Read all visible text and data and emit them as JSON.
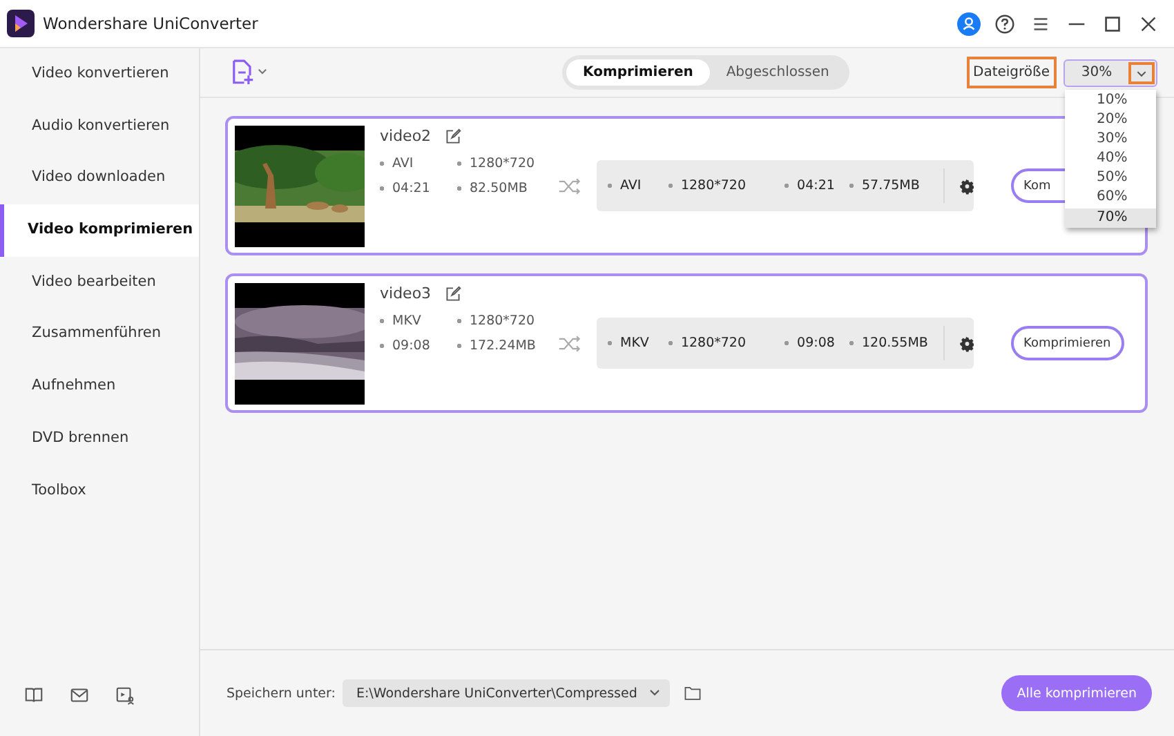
{
  "window": {
    "title": "Wondershare UniConverter"
  },
  "sidebar": {
    "items": [
      {
        "label": "Video konvertieren",
        "selected": false
      },
      {
        "label": "Audio konvertieren",
        "selected": false
      },
      {
        "label": "Video downloaden",
        "selected": false
      },
      {
        "label": "Video komprimieren",
        "selected": true
      },
      {
        "label": "Video bearbeiten",
        "selected": false
      },
      {
        "label": "Zusammenführen",
        "selected": false
      },
      {
        "label": "Aufnehmen",
        "selected": false
      },
      {
        "label": "DVD brennen",
        "selected": false
      },
      {
        "label": "Toolbox",
        "selected": false
      }
    ]
  },
  "tabs": [
    {
      "label": "Komprimieren",
      "selected": true
    },
    {
      "label": "Abgeschlossen",
      "selected": false
    }
  ],
  "file_size": {
    "label": "Dateigröße",
    "label_highlighted": true,
    "value": "30%",
    "arrow_highlighted": true,
    "options": [
      {
        "label": "10%",
        "highlighted": false
      },
      {
        "label": "20%",
        "highlighted": false
      },
      {
        "label": "30%",
        "highlighted": false
      },
      {
        "label": "40%",
        "highlighted": false
      },
      {
        "label": "50%",
        "highlighted": false
      },
      {
        "label": "60%",
        "highlighted": false
      },
      {
        "label": "70%",
        "highlighted": true
      }
    ]
  },
  "videos": [
    {
      "name": "video2",
      "source": {
        "format": "AVI",
        "resolution": "1280*720",
        "duration": "04:21",
        "size": "82.50MB"
      },
      "output": {
        "format": "AVI",
        "resolution": "1280*720",
        "duration": "04:21",
        "size": "57.75MB"
      },
      "button": "Kom"
    },
    {
      "name": "video3",
      "source": {
        "format": "MKV",
        "resolution": "1280*720",
        "duration": "09:08",
        "size": "172.24MB"
      },
      "output": {
        "format": "MKV",
        "resolution": "1280*720",
        "duration": "09:08",
        "size": "120.55MB"
      },
      "button": "Komprimieren"
    }
  ],
  "footer": {
    "save_label": "Speichern unter:",
    "path": "E:\\Wondershare UniConverter\\Compressed",
    "button": "Alle komprimieren"
  }
}
